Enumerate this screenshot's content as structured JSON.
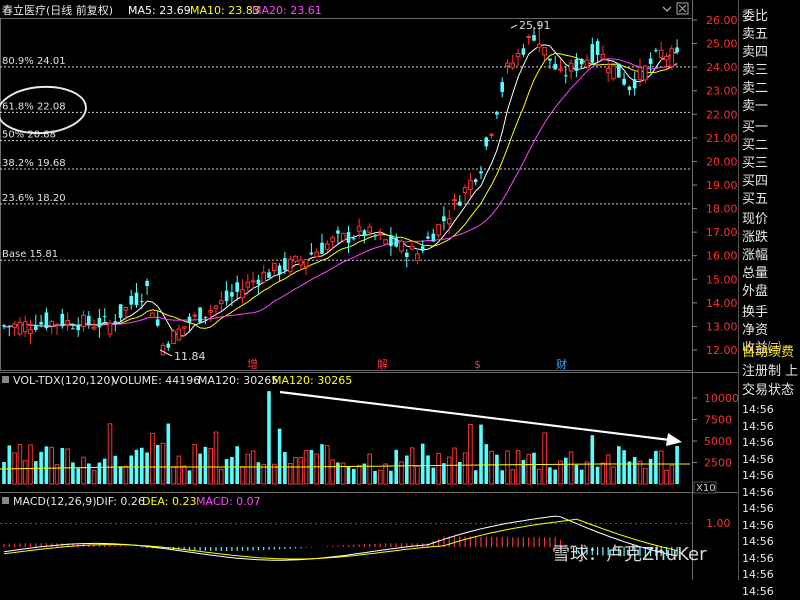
{
  "header": {
    "title": "春立医疗(日线 前复权)",
    "ma5": "MA5: 23.69",
    "ma10": "MA10: 23.83",
    "ma20": "MA20: 23.61",
    "colors": {
      "ma5": "#ffffff",
      "ma10": "#ffff00",
      "ma20": "#ff44ff"
    }
  },
  "fib_levels": [
    {
      "label": "80.9% 24.01",
      "value": 24.01
    },
    {
      "label": "61.8% 22.08",
      "value": 22.08
    },
    {
      "label": "50% 20.88",
      "value": 20.88
    },
    {
      "label": "38.2% 19.68",
      "value": 19.68
    },
    {
      "label": "23.6% 18.20",
      "value": 18.2
    },
    {
      "label": "Base 15.81",
      "value": 15.81
    }
  ],
  "annotations": {
    "high": "25.91",
    "low": "11.84",
    "high_value": 25.91,
    "low_value": 11.84
  },
  "event_markers": [
    {
      "label": "增",
      "color": "#ff3030"
    },
    {
      "label": "解",
      "color": "#ff3030"
    },
    {
      "label": "$",
      "color": "#ff3030"
    },
    {
      "label": "财",
      "color": "#33aaff"
    }
  ],
  "volume_header": {
    "name": "VOL-TDX(120,120)",
    "volume": "VOLUME: 44196",
    "ma120": "MA120: 30265",
    "ma120b": "MA120: 30265"
  },
  "macd_header": {
    "name": "MACD(12,26,9)",
    "dif": "DIF: 0.26",
    "dea": "DEA: 0.23",
    "macd": "MACD: 0.07"
  },
  "unit_badge": "X10",
  "chart_data": [
    {
      "type": "candlestick",
      "title": "春立医疗(日线 前复权)",
      "y_ticks": [
        "26.00",
        "25.00",
        "24.00",
        "23.00",
        "22.00",
        "21.00",
        "20.00",
        "19.00",
        "18.00",
        "17.00",
        "16.00",
        "15.00",
        "14.00",
        "13.00",
        "12.00"
      ],
      "ylim": [
        11.5,
        26.3
      ],
      "bars": 128,
      "close_path": [
        [
          0,
          13.0
        ],
        [
          10,
          13.2
        ],
        [
          20,
          13.1
        ],
        [
          27,
          14.6
        ],
        [
          30,
          12.2
        ],
        [
          35,
          13.2
        ],
        [
          42,
          14.1
        ],
        [
          48,
          15.1
        ],
        [
          55,
          15.7
        ],
        [
          62,
          16.6
        ],
        [
          68,
          17.0
        ],
        [
          73,
          16.5
        ],
        [
          78,
          16.1
        ],
        [
          84,
          17.8
        ],
        [
          90,
          19.8
        ],
        [
          95,
          23.9
        ],
        [
          100,
          25.4
        ],
        [
          105,
          23.6
        ],
        [
          112,
          24.7
        ],
        [
          118,
          23.2
        ],
        [
          124,
          24.6
        ],
        [
          127,
          24.4
        ]
      ]
    },
    {
      "type": "bar",
      "title": "VOL-TDX(120,120)",
      "y_ticks": [
        "10000",
        "7500",
        "5000",
        "2500"
      ],
      "ylim": [
        0,
        11000
      ],
      "last_volume": 44196,
      "ma120": 30265
    },
    {
      "type": "line",
      "title": "MACD(12,26,9)",
      "y_ticks": [
        "1.00"
      ],
      "dif": 0.26,
      "dea": 0.23,
      "macd": 0.07
    }
  ],
  "side_panel": {
    "items": [
      "委比",
      "卖五",
      "卖四",
      "卖三",
      "卖二",
      "卖一",
      "买一",
      "买二",
      "买三",
      "买四",
      "买五",
      "现价",
      "涨跌",
      "涨幅",
      "总量",
      "外盘",
      "换手",
      "净资",
      "收益㈢"
    ],
    "auto_label": "自动续费",
    "reg_label": "注册制 上",
    "trade_label": "交易状态",
    "times": [
      "14:56",
      "14:56",
      "14:56",
      "14:56",
      "14:56",
      "14:56",
      "14:56",
      "14:56",
      "14:56",
      "14:56",
      "14:56",
      "14:56"
    ]
  },
  "watermark": "雪球：卢克ZhuKer"
}
